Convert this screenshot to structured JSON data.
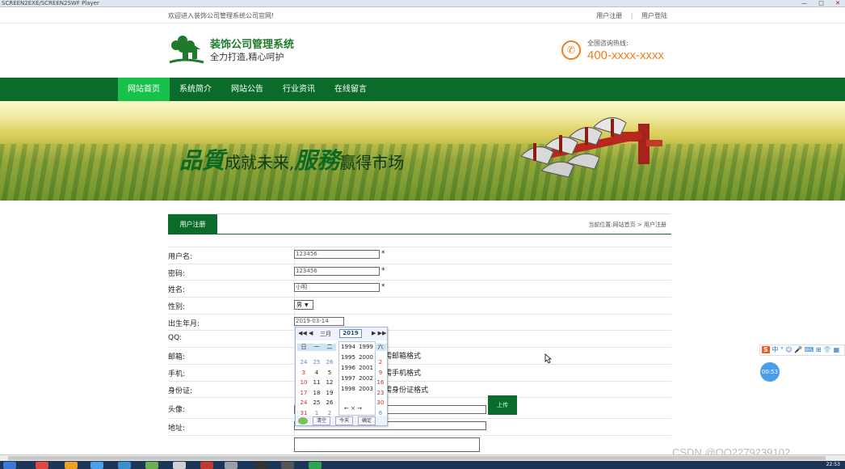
{
  "window": {
    "title": "SCREEN2EXE/SCREEN2SWF Player",
    "controls": [
      "—",
      "□",
      "✕"
    ]
  },
  "topbar": {
    "welcome": "欢迎进入装饰公司管理系统公司官网!",
    "links": [
      "用户注册",
      "用户登陆"
    ],
    "separator": "|"
  },
  "header": {
    "title": "装饰公司管理系统",
    "slogan": "全力打造,精心呵护",
    "hotline_label": "全国咨询热线:",
    "hotline_number": "400-xxxx-xxxx",
    "brand_color": "#1f7a2b",
    "accent_color": "#f07d1a"
  },
  "nav": {
    "items": [
      "网站首页",
      "系统简介",
      "网站公告",
      "行业资讯",
      "在线留言"
    ],
    "active_index": 0,
    "bg_color": "#0b6b2a",
    "active_color": "#17c14a"
  },
  "banner": {
    "slogan_part1": "品質",
    "slogan_part2": "成就未来,",
    "slogan_part3": "服務",
    "slogan_part4": "赢得市场"
  },
  "content": {
    "tab": "用户注册",
    "breadcrumb": "当前位置:网站首页 > 用户注册"
  },
  "form": {
    "username": {
      "label": "用户名:",
      "value": "123456",
      "required": "*"
    },
    "password": {
      "label": "密码:",
      "value": "123456",
      "required": "*"
    },
    "name": {
      "label": "姓名:",
      "value": "小明",
      "required": "*"
    },
    "gender": {
      "label": "性别:",
      "value": "男",
      "arrow": "▼"
    },
    "birthdate": {
      "label": "出生年月:",
      "value": "2019-03-14"
    },
    "qq": {
      "label": "QQ:"
    },
    "email": {
      "label": "邮箱:",
      "hint": "需邮箱格式"
    },
    "phone": {
      "label": "手机:",
      "hint": "需手机格式"
    },
    "idcard": {
      "label": "身份证:",
      "hint": "需身份证格式"
    },
    "avatar": {
      "label": "头像:",
      "button": "上传"
    },
    "address": {
      "label": "地址:"
    }
  },
  "datepicker": {
    "nav_prev": "◀◀ ◀",
    "month": "三月",
    "year": "2019",
    "nav_next": "▶ ▶▶",
    "weekday_headers": [
      "日",
      "一",
      "二"
    ],
    "right_header": "六",
    "day_rows": [
      [
        "24",
        "25",
        "26"
      ],
      [
        "3",
        "4",
        "5"
      ],
      [
        "10",
        "11",
        "12"
      ],
      [
        "17",
        "18",
        "19"
      ],
      [
        "24",
        "25",
        "26"
      ],
      [
        "31",
        "1",
        "2",
        "3",
        "4",
        "5"
      ]
    ],
    "right_column": [
      "2",
      "9",
      "16",
      "23",
      "30",
      "6"
    ],
    "years": [
      [
        "1994",
        "1999"
      ],
      [
        "1995",
        "2000"
      ],
      [
        "1996",
        "2001"
      ],
      [
        "1997",
        "2002"
      ],
      [
        "1998",
        "2003"
      ]
    ],
    "year_nav": "← × →",
    "footer_buttons": [
      "清空",
      "今天",
      "确定"
    ]
  },
  "widgets": {
    "ime_logo": "S",
    "ime_text": "中 ° ☺ 🎤 ⌨ ⊞ 👕 ▦",
    "timer": "00:53"
  },
  "watermark": "CSDN @QQ2279239102",
  "taskbar": {
    "clock": "22:53"
  }
}
